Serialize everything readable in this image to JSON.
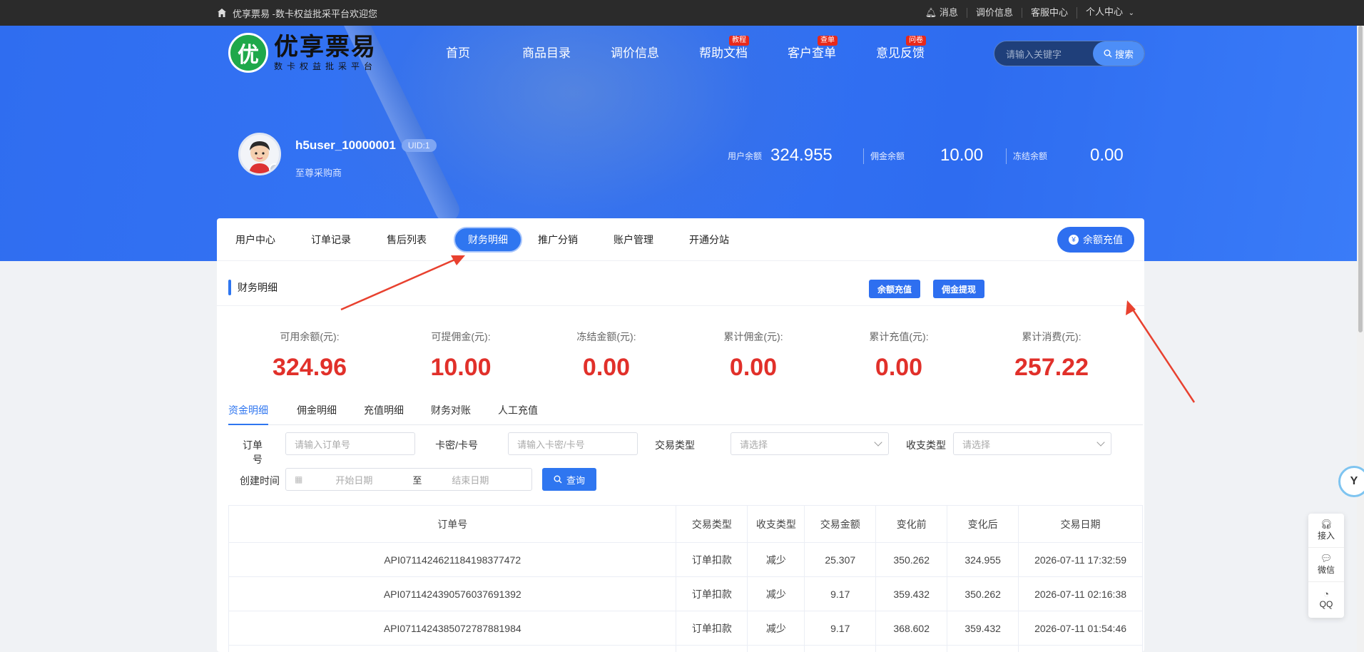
{
  "topbar": {
    "welcome": "优享票易 -数卡权益批采平台欢迎您",
    "links": [
      "消息",
      "调价信息",
      "客服中心",
      "个人中心"
    ]
  },
  "logo": {
    "mark": "优",
    "name": "优享票易",
    "slogan": "数卡权益批采平台"
  },
  "nav": [
    {
      "label": "首页",
      "badge": ""
    },
    {
      "label": "商品目录",
      "badge": ""
    },
    {
      "label": "调价信息",
      "badge": ""
    },
    {
      "label": "帮助文档",
      "badge": "教程"
    },
    {
      "label": "客户查单",
      "badge": "查单"
    },
    {
      "label": "意见反馈",
      "badge": "问卷"
    }
  ],
  "search": {
    "placeholder": "请输入关键字",
    "button": "搜索"
  },
  "user": {
    "name": "h5user_10000001",
    "uid": "UID:1",
    "level": "至尊采购商"
  },
  "balances": [
    {
      "label": "用户余额",
      "value": "324.955"
    },
    {
      "label": "佣金余额",
      "value": "10.00"
    },
    {
      "label": "冻结余额",
      "value": "0.00"
    }
  ],
  "tabs": [
    "用户中心",
    "订单记录",
    "售后列表",
    "财务明细",
    "推广分销",
    "账户管理",
    "开通分站"
  ],
  "active_tab": "财务明细",
  "recharge_top": "余额充值",
  "section": {
    "title": "财务明细",
    "btn_recharge": "余额充值",
    "btn_withdraw": "佣金提现"
  },
  "stats": [
    {
      "label": "可用余额(元):",
      "value": "324.96"
    },
    {
      "label": "可提佣金(元):",
      "value": "10.00"
    },
    {
      "label": "冻结金额(元):",
      "value": "0.00"
    },
    {
      "label": "累计佣金(元):",
      "value": "0.00"
    },
    {
      "label": "累计充值(元):",
      "value": "0.00"
    },
    {
      "label": "累计消费(元):",
      "value": "257.22"
    }
  ],
  "subtabs": [
    "资金明细",
    "佣金明细",
    "充值明细",
    "财务对账",
    "人工充值"
  ],
  "filters": {
    "order_label": "订单号",
    "order_placeholder": "请输入订单号",
    "card_label": "卡密/卡号",
    "card_placeholder": "请输入卡密/卡号",
    "trade_label": "交易类型",
    "trade_placeholder": "请选择",
    "io_label": "收支类型",
    "io_placeholder": "请选择",
    "time_label": "创建时间",
    "start_placeholder": "开始日期",
    "to": "至",
    "end_placeholder": "结束日期",
    "query": "查询"
  },
  "table": {
    "headers": [
      "订单号",
      "交易类型",
      "收支类型",
      "交易金额",
      "变化前",
      "变化后",
      "交易日期"
    ],
    "rows": [
      [
        "API071142462118419837747​2",
        "订单扣款",
        "减少",
        "25.307",
        "350.262",
        "324.955",
        "2026-07-11 17:32:59"
      ],
      [
        "API0711424390576037691392",
        "订单扣款",
        "减少",
        "9.17",
        "359.432",
        "350.262",
        "2026-07-11 02:16:38"
      ],
      [
        "API0711424385072787881984",
        "订单扣款",
        "减少",
        "9.17",
        "368.602",
        "359.432",
        "2026-07-11 01:54:46"
      ]
    ]
  },
  "side": [
    "接入",
    "微信",
    "QQ"
  ]
}
